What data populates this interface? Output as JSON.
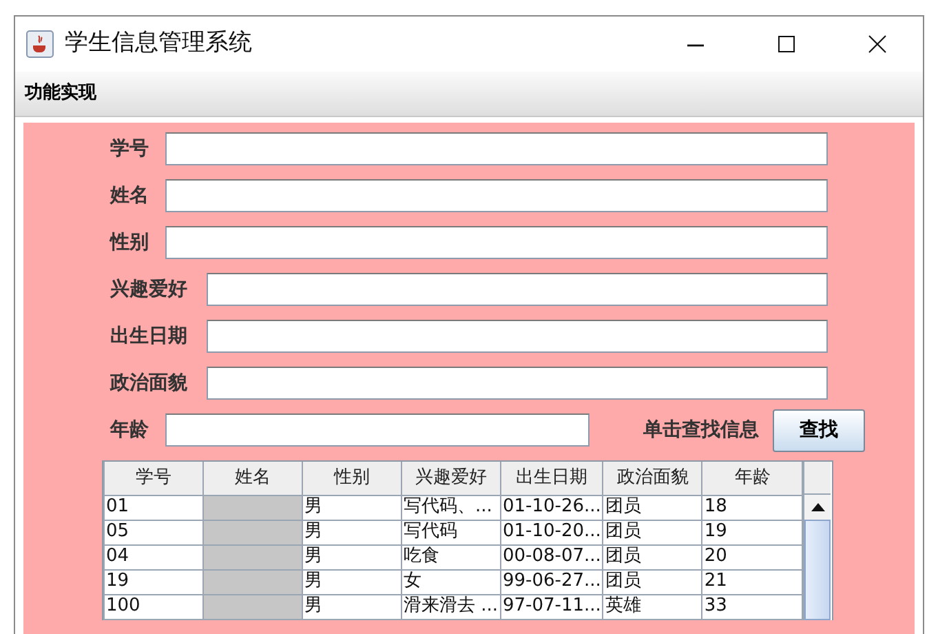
{
  "window": {
    "title": "学生信息管理系统"
  },
  "menu": [
    "功能实现"
  ],
  "form": {
    "fields": [
      {
        "label": "学号",
        "kind": "short"
      },
      {
        "label": "姓名",
        "kind": "short"
      },
      {
        "label": "性别",
        "kind": "short"
      },
      {
        "label": "兴趣爱好",
        "kind": "long"
      },
      {
        "label": "出生日期",
        "kind": "long"
      },
      {
        "label": "政治面貌",
        "kind": "long"
      }
    ],
    "age": {
      "label": "年龄"
    },
    "search_hint": "单击查找信息",
    "search_button": "查找"
  },
  "table": {
    "columns": [
      "学号",
      "姓名",
      "性别",
      "兴趣爱好",
      "出生日期",
      "政治面貌",
      "年龄"
    ],
    "rows": [
      [
        "01",
        "",
        "男",
        "写代码、...",
        "01-10-26...",
        "团员",
        "18"
      ],
      [
        "05",
        "",
        "男",
        "写代码",
        "01-10-20...",
        "团员",
        "19"
      ],
      [
        "04",
        "",
        "男",
        "吃食",
        "00-08-07...",
        "团员",
        "20"
      ],
      [
        "19",
        "",
        "男",
        "女",
        "99-06-27...",
        "团员",
        "21"
      ],
      [
        "100",
        "",
        "男",
        "滑来滑去 ...",
        "97-07-11...",
        "英雄",
        "33"
      ]
    ]
  }
}
